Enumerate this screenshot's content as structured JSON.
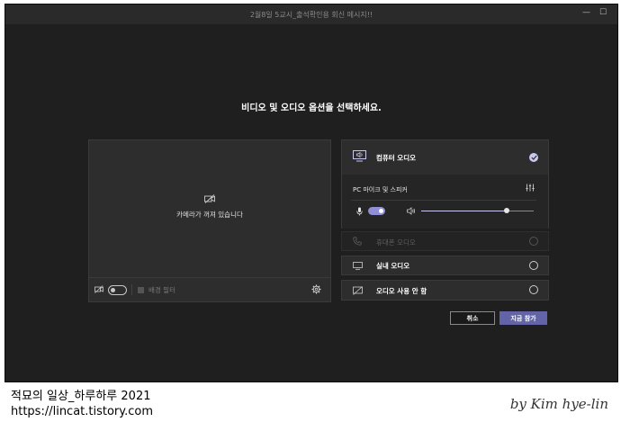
{
  "window": {
    "title": "2월8일 5교시_출석확인용 회신 메시지!!",
    "min_glyph": "—",
    "max_glyph": "☐"
  },
  "heading": "비디오 및 오디오 옵션을 선택하세요.",
  "video": {
    "camera_off_text": "카메라가 꺼져 있습니다",
    "camera_toggle_on": false,
    "background_filter_label": "배경 필터"
  },
  "audio": {
    "computer_audio_label": "컴퓨터 오디오",
    "computer_audio_selected": true,
    "device_label": "PC 마이크 및 스피커",
    "mic_toggle_on": true,
    "volume_level": 0.76,
    "phone_audio_label": "휴대폰 오디오",
    "room_audio_label": "실내 오디오",
    "no_audio_label": "오디오 사용 안 함"
  },
  "buttons": {
    "cancel_label": "취소",
    "join_label": "지금 참가"
  },
  "captions": {
    "blog_title": "적묘의 일상_하루하루 2021",
    "blog_url": "https://lincat.tistory.com",
    "signature": "by Kim hye-lin"
  },
  "colors": {
    "accent": "#6264a7",
    "toggle_on": "#8f8fd8",
    "check": "#c9c9ef"
  },
  "icons": {
    "computer_audio": "monitor-speaker-icon",
    "phone_audio": "phone-icon",
    "room_audio": "room-display-icon",
    "no_audio": "audio-off-icon",
    "camera_off": "camera-off-icon",
    "settings": "gear-icon",
    "device_settings": "sliders-icon",
    "mic": "mic-icon",
    "speaker": "speaker-icon"
  }
}
